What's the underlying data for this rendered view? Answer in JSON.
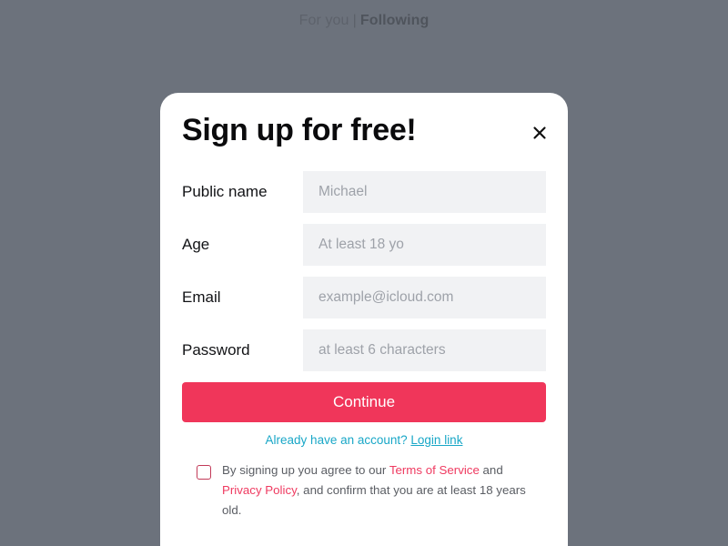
{
  "background_nav": {
    "for_you": "For you",
    "separator": "|",
    "following": "Following"
  },
  "modal": {
    "title": "Sign up for free!",
    "close_icon": "close-icon"
  },
  "form": {
    "fields": [
      {
        "label": "Public name",
        "placeholder": "Michael",
        "value": ""
      },
      {
        "label": "Age",
        "placeholder": "At least 18 yo",
        "value": ""
      },
      {
        "label": "Email",
        "placeholder": "example@icloud.com",
        "value": ""
      },
      {
        "label": "Password",
        "placeholder": "at least 6 characters",
        "value": ""
      }
    ],
    "continue_label": "Continue"
  },
  "login": {
    "prompt": "Already have an account?",
    "link_label": "Login link"
  },
  "terms": {
    "checked": false,
    "text_before": "By signing up you agree to our ",
    "terms_link": "Terms of Service",
    "text_and": " and",
    "privacy_link": "Privacy Policy",
    "text_after": ", and confirm that you are at least 18 years old."
  },
  "colors": {
    "backdrop": "#6c727c",
    "accent": "#f0365a",
    "link": "#19a7c7",
    "input_bg": "#f1f2f4"
  }
}
